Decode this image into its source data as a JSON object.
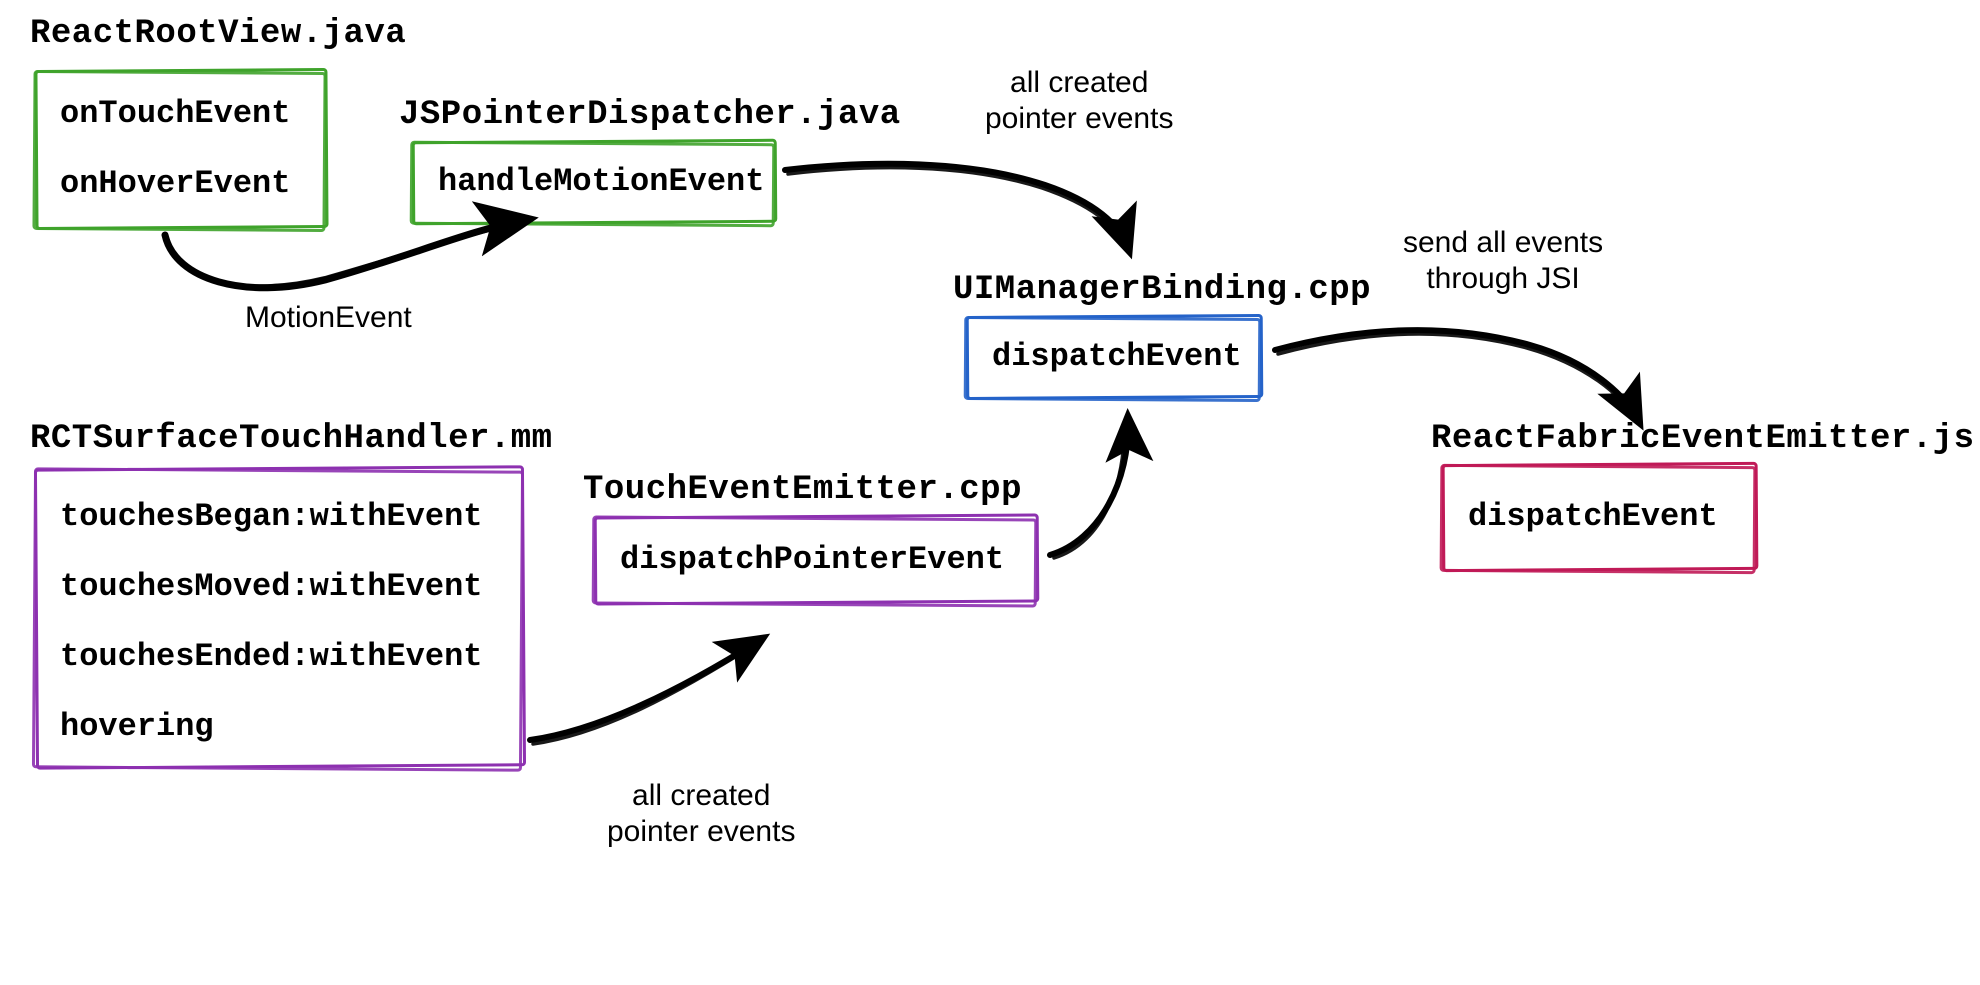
{
  "nodes": {
    "reactRootView": {
      "title": "ReactRootView.java",
      "methods": [
        "onTouchEvent",
        "onHoverEvent"
      ]
    },
    "jsPointerDispatcher": {
      "title": "JSPointerDispatcher.java",
      "methods": [
        "handleMotionEvent"
      ]
    },
    "uiManagerBinding": {
      "title": "UIManagerBinding.cpp",
      "methods": [
        "dispatchEvent"
      ]
    },
    "rctSurfaceTouchHandler": {
      "title": "RCTSurfaceTouchHandler.mm",
      "methods": [
        "touchesBegan:withEvent",
        "touchesMoved:withEvent",
        "touchesEnded:withEvent",
        "hovering"
      ]
    },
    "touchEventEmitter": {
      "title": "TouchEventEmitter.cpp",
      "methods": [
        "dispatchPointerEvent"
      ]
    },
    "reactFabricEventEmitter": {
      "title": "ReactFabricEventEmitter.js",
      "methods": [
        "dispatchEvent"
      ]
    }
  },
  "edges": {
    "motionEvent": "MotionEvent",
    "allCreatedPointerEvents": "all created\npointer events",
    "sendAllEventsThroughJSI": "send all events\nthrough JSI"
  },
  "colors": {
    "green": "#3fa32b",
    "purple": "#8d31b0",
    "blue": "#2563c9",
    "magenta": "#c01a57",
    "ink": "#000000"
  }
}
